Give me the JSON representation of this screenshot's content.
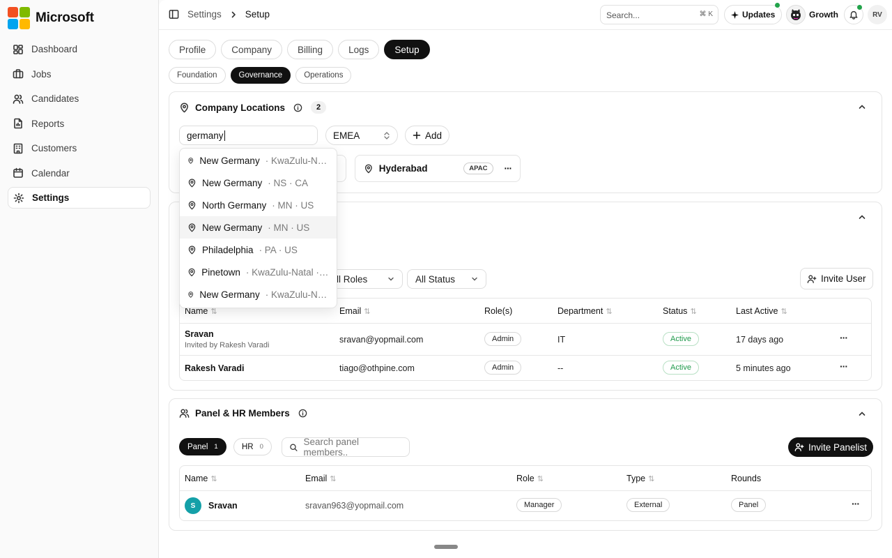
{
  "brand": {
    "name": "Microsoft",
    "colors": [
      "#f25022",
      "#7fba00",
      "#00a4ef",
      "#ffb900"
    ]
  },
  "sidebar": {
    "items": [
      {
        "label": "Dashboard",
        "icon": "dashboard-icon"
      },
      {
        "label": "Jobs",
        "icon": "briefcase-icon"
      },
      {
        "label": "Candidates",
        "icon": "users-icon"
      },
      {
        "label": "Reports",
        "icon": "report-icon"
      },
      {
        "label": "Customers",
        "icon": "building-icon"
      },
      {
        "label": "Calendar",
        "icon": "calendar-icon"
      },
      {
        "label": "Settings",
        "icon": "gear-icon",
        "active": true
      }
    ]
  },
  "topbar": {
    "breadcrumb": [
      "Settings",
      "Setup"
    ],
    "search_placeholder": "Search...",
    "search_shortcut": "⌘ K",
    "updates_label": "Updates",
    "workspace_label": "Growth",
    "user_initials": "RV"
  },
  "tabs": [
    "Profile",
    "Company",
    "Billing",
    "Logs",
    "Setup"
  ],
  "subtabs": [
    "Foundation",
    "Governance",
    "Operations"
  ],
  "locations": {
    "title": "Company Locations",
    "count": "2",
    "search_value": "germany",
    "region_value": "EMEA",
    "add_label": "Add",
    "chips": [
      {
        "name": "Hyderabad",
        "region": "APAC"
      }
    ],
    "suggestions": [
      {
        "name": "New Germany",
        "detail": "· KwaZulu-Natal · ZA"
      },
      {
        "name": "New Germany",
        "detail": "· NS · CA"
      },
      {
        "name": "North Germany",
        "detail": "· MN · US"
      },
      {
        "name": "New Germany",
        "detail": "· MN · US"
      },
      {
        "name": "Philadelphia",
        "detail": "· PA · US"
      },
      {
        "name": "Pinetown",
        "detail": "· KwaZulu-Natal · ZA"
      },
      {
        "name": "New Germany",
        "detail": "· KwaZulu-Natal · ZA"
      }
    ]
  },
  "users": {
    "roles_filter": "ll Roles",
    "status_filter": "All Status",
    "invite_label": "Invite User",
    "columns": [
      "Name",
      "Email",
      "Role(s)",
      "Department",
      "Status",
      "Last Active"
    ],
    "rows": [
      {
        "name": "Sravan",
        "note": "Invited by Rakesh Varadi",
        "email": "sravan@yopmail.com",
        "role": "Admin",
        "department": "IT",
        "status": "Active",
        "last_active": "17 days ago"
      },
      {
        "name": "Rakesh Varadi",
        "note": "",
        "email": "tiago@othpine.com",
        "role": "Admin",
        "department": "--",
        "status": "Active",
        "last_active": "5 minutes ago"
      }
    ]
  },
  "panel": {
    "title": "Panel & HR Members",
    "toggle_panel": "Panel",
    "toggle_panel_count": "1",
    "toggle_hr": "HR",
    "toggle_hr_count": "0",
    "search_placeholder": "Search panel members..",
    "invite_label": "Invite Panelist",
    "columns": [
      "Name",
      "Email",
      "Role",
      "Type",
      "Rounds"
    ],
    "rows": [
      {
        "initial": "S",
        "name": "Sravan",
        "email": "sravan963@yopmail.com",
        "role": "Manager",
        "type": "External",
        "rounds": "Panel"
      }
    ]
  }
}
